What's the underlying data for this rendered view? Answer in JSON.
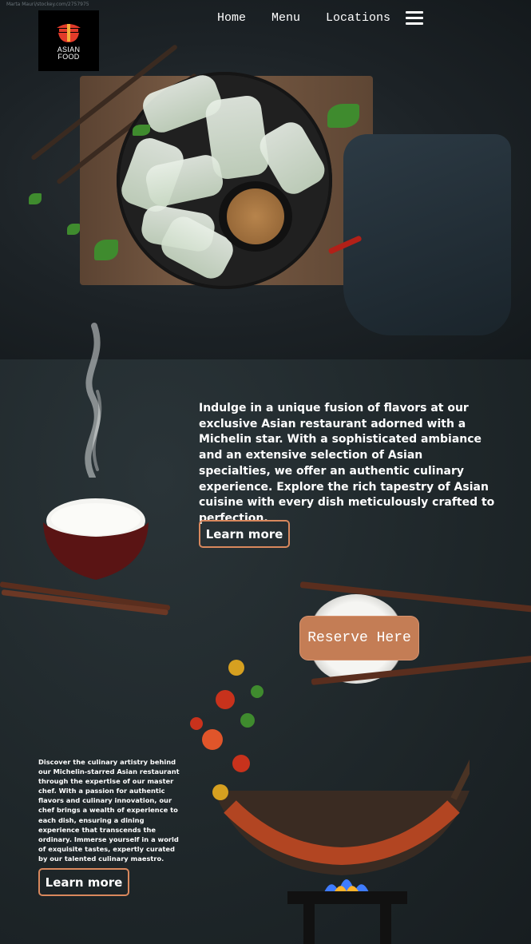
{
  "photo_credit": "Marta Mauri/stockey.com/2757975",
  "logo": {
    "line1": "ASIAN",
    "line2": "FOOD",
    "icon": "lantern-bowl-icon",
    "color": "#e23b2a"
  },
  "nav": {
    "items": [
      "Home",
      "Menu",
      "Locations"
    ],
    "menu_icon": "hamburger-icon"
  },
  "intro": {
    "text": "Indulge in a unique fusion of flavors at our exclusive Asian restaurant adorned with a Michelin star. With a sophisticated ambiance and an extensive selection of Asian specialties, we offer an authentic culinary experience. Explore the rich tapestry of Asian cuisine with every dish meticulously crafted to perfection.",
    "button": "Learn more"
  },
  "reserve": {
    "button": "Reserve Here",
    "color": "#c47d55"
  },
  "chef": {
    "text": "Discover the culinary artistry behind our Michelin-starred Asian restaurant through the expertise of our master chef. With a passion for authentic flavors and culinary innovation, our chef brings a wealth of experience to each dish, ensuring a dining experience that transcends the ordinary. Immerse yourself in a world of exquisite tastes, expertly curated by our talented culinary maestro.",
    "button": "Learn more"
  },
  "accent": "#d9885d"
}
